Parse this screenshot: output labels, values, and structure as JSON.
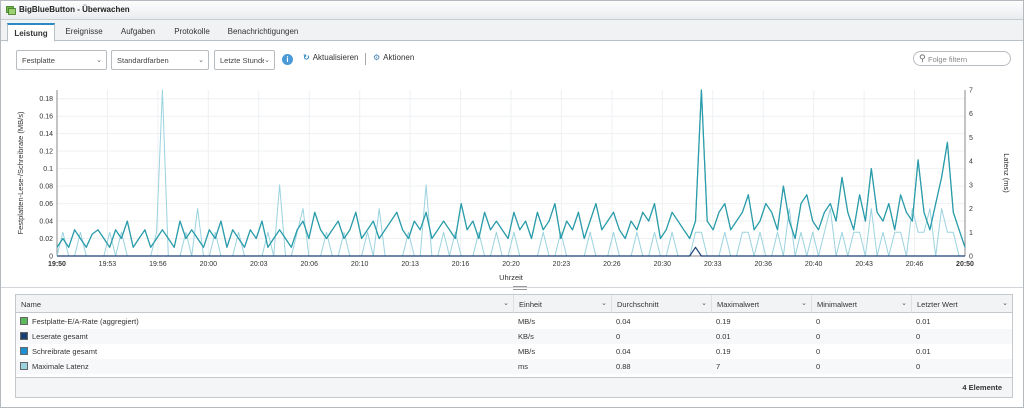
{
  "window": {
    "title": "BigBlueButton - Überwachen"
  },
  "tabs": [
    "Leistung",
    "Ereignisse",
    "Aufgaben",
    "Protokolle",
    "Benachrichtigungen"
  ],
  "toolbar": {
    "metric_select": "Festplatte",
    "color_select": "Standardfarben",
    "range_select": "Letzte Stunde",
    "refresh_label": "Aktualisieren",
    "actions_label": "Aktionen",
    "filter_placeholder": "Folge filtern"
  },
  "chart_data": {
    "type": "line",
    "xlabel": "Uhrzeit",
    "ylabel_left": "Festplatten-Lese-/Schreibrate (MB/s)",
    "ylabel_right": "Latenz (ms)",
    "ylim_left": [
      0,
      0.19
    ],
    "ylim_right": [
      0,
      7
    ],
    "yticks_left": [
      "0",
      "0.02",
      "0.04",
      "0.06",
      "0.08",
      "0.1",
      "0.12",
      "0.14",
      "0.16",
      "0.18"
    ],
    "yticks_right": [
      "0",
      "1",
      "2",
      "3",
      "4",
      "5",
      "6",
      "7"
    ],
    "xticks": [
      "19:50",
      "19:53",
      "19:56",
      "20:00",
      "20:03",
      "20:06",
      "20:10",
      "20:13",
      "20:16",
      "20:20",
      "20:23",
      "20:26",
      "20:30",
      "20:33",
      "20:36",
      "20:40",
      "20:43",
      "20:46",
      "20:50"
    ],
    "grid": true,
    "series": [
      {
        "name": "Festplatte-E/A-Rate (aggregiert)",
        "color": "#5cb85c",
        "values": [
          0.01,
          0.02,
          0.01,
          0.03,
          0.02,
          0.01,
          0.025,
          0.03,
          0.02,
          0.01,
          0.03,
          0.02,
          0.04,
          0.01,
          0.02,
          0.03,
          0.01,
          0.02,
          0.03,
          0.02,
          0.01,
          0.04,
          0.02,
          0.03,
          0.02,
          0.01,
          0.03,
          0.02,
          0.04,
          0.01,
          0.03,
          0.02,
          0.01,
          0.03,
          0.02,
          0.04,
          0.01,
          0.02,
          0.03,
          0.02,
          0.01,
          0.03,
          0.04,
          0.02,
          0.05,
          0.03,
          0.02,
          0.03,
          0.04,
          0.02,
          0.03,
          0.05,
          0.02,
          0.03,
          0.04,
          0.02,
          0.03,
          0.04,
          0.05,
          0.03,
          0.02,
          0.04,
          0.03,
          0.05,
          0.02,
          0.03,
          0.04,
          0.03,
          0.02,
          0.06,
          0.03,
          0.04,
          0.02,
          0.05,
          0.03,
          0.04,
          0.03,
          0.02,
          0.05,
          0.03,
          0.04,
          0.02,
          0.05,
          0.03,
          0.04,
          0.06,
          0.02,
          0.04,
          0.03,
          0.05,
          0.02,
          0.04,
          0.06,
          0.03,
          0.04,
          0.05,
          0.03,
          0.02,
          0.04,
          0.03,
          0.05,
          0.04,
          0.06,
          0.02,
          0.03,
          0.05,
          0.04,
          0.03,
          0.02,
          0.04,
          0.19,
          0.04,
          0.03,
          0.05,
          0.06,
          0.03,
          0.04,
          0.05,
          0.07,
          0.03,
          0.04,
          0.06,
          0.05,
          0.03,
          0.08,
          0.04,
          0.02,
          0.06,
          0.07,
          0.04,
          0.03,
          0.05,
          0.06,
          0.04,
          0.09,
          0.05,
          0.03,
          0.07,
          0.04,
          0.1,
          0.05,
          0.04,
          0.06,
          0.03,
          0.07,
          0.05,
          0.04,
          0.11,
          0.05,
          0.03,
          0.06,
          0.09,
          0.13,
          0.05,
          0.03,
          0.01
        ]
      },
      {
        "name": "Leserate gesamt",
        "color": "#1c3f73",
        "values": [
          0,
          0,
          0,
          0,
          0,
          0,
          0,
          0,
          0,
          0,
          0,
          0,
          0,
          0,
          0,
          0,
          0,
          0,
          0,
          0,
          0,
          0,
          0,
          0,
          0,
          0,
          0,
          0,
          0,
          0,
          0,
          0,
          0,
          0,
          0,
          0,
          0,
          0,
          0,
          0,
          0,
          0,
          0,
          0,
          0,
          0,
          0,
          0,
          0,
          0,
          0,
          0,
          0,
          0,
          0,
          0,
          0,
          0,
          0,
          0,
          0,
          0,
          0,
          0,
          0,
          0,
          0,
          0,
          0,
          0,
          0,
          0,
          0,
          0,
          0,
          0,
          0,
          0,
          0,
          0,
          0,
          0,
          0,
          0,
          0,
          0,
          0,
          0,
          0,
          0,
          0,
          0,
          0,
          0,
          0,
          0,
          0,
          0,
          0,
          0,
          0,
          0,
          0,
          0,
          0,
          0,
          0,
          0,
          0,
          0.01,
          0,
          0,
          0,
          0,
          0,
          0,
          0,
          0,
          0,
          0,
          0,
          0,
          0,
          0,
          0,
          0,
          0,
          0,
          0,
          0,
          0,
          0,
          0,
          0,
          0,
          0,
          0,
          0,
          0,
          0,
          0,
          0,
          0,
          0,
          0,
          0,
          0,
          0,
          0,
          0,
          0,
          0,
          0,
          0,
          0,
          0
        ]
      },
      {
        "name": "Schreibrate gesamt",
        "color": "#2a9bb5",
        "values": [
          0.01,
          0.02,
          0.01,
          0.03,
          0.02,
          0.01,
          0.025,
          0.03,
          0.02,
          0.01,
          0.03,
          0.02,
          0.04,
          0.01,
          0.02,
          0.03,
          0.01,
          0.02,
          0.03,
          0.02,
          0.01,
          0.04,
          0.02,
          0.03,
          0.02,
          0.01,
          0.03,
          0.02,
          0.04,
          0.01,
          0.03,
          0.02,
          0.01,
          0.03,
          0.02,
          0.04,
          0.01,
          0.02,
          0.03,
          0.02,
          0.01,
          0.03,
          0.04,
          0.02,
          0.05,
          0.03,
          0.02,
          0.03,
          0.04,
          0.02,
          0.03,
          0.05,
          0.02,
          0.03,
          0.04,
          0.02,
          0.03,
          0.04,
          0.05,
          0.03,
          0.02,
          0.04,
          0.03,
          0.05,
          0.02,
          0.03,
          0.04,
          0.03,
          0.02,
          0.06,
          0.03,
          0.04,
          0.02,
          0.05,
          0.03,
          0.04,
          0.03,
          0.02,
          0.05,
          0.03,
          0.04,
          0.02,
          0.05,
          0.03,
          0.04,
          0.06,
          0.02,
          0.04,
          0.03,
          0.05,
          0.02,
          0.04,
          0.06,
          0.03,
          0.04,
          0.05,
          0.03,
          0.02,
          0.04,
          0.03,
          0.05,
          0.04,
          0.06,
          0.02,
          0.03,
          0.05,
          0.04,
          0.03,
          0.02,
          0.04,
          0.19,
          0.04,
          0.03,
          0.05,
          0.06,
          0.03,
          0.04,
          0.05,
          0.07,
          0.03,
          0.04,
          0.06,
          0.05,
          0.03,
          0.08,
          0.04,
          0.02,
          0.06,
          0.07,
          0.04,
          0.03,
          0.05,
          0.06,
          0.04,
          0.09,
          0.05,
          0.03,
          0.07,
          0.04,
          0.1,
          0.05,
          0.04,
          0.06,
          0.03,
          0.07,
          0.05,
          0.04,
          0.11,
          0.05,
          0.03,
          0.06,
          0.09,
          0.13,
          0.05,
          0.03,
          0.01
        ]
      },
      {
        "name": "Maximale Latenz",
        "color": "#9bd3df",
        "axis": "right",
        "values": [
          0,
          1,
          0,
          0,
          1,
          0,
          0,
          0,
          0,
          1,
          0,
          1,
          0,
          0,
          0,
          0,
          0,
          1,
          7,
          0,
          0,
          0,
          1,
          0,
          2,
          0,
          0,
          1,
          0,
          0,
          0,
          1,
          0,
          0,
          0,
          0,
          1,
          0,
          3,
          0,
          0,
          1,
          2,
          0,
          0,
          0,
          1,
          0,
          0,
          1,
          0,
          0,
          0,
          1,
          0,
          2,
          0,
          0,
          0,
          0,
          1,
          0,
          0,
          3,
          0,
          0,
          1,
          0,
          1,
          0,
          0,
          0,
          1,
          0,
          0,
          1,
          0,
          0,
          1,
          0,
          0,
          0,
          0,
          1,
          0,
          0,
          1,
          0,
          0,
          0,
          0,
          1,
          0,
          0,
          0,
          1,
          0,
          0,
          0,
          1,
          0,
          0,
          1,
          0,
          0,
          1,
          0,
          0,
          0,
          1,
          1,
          0,
          0,
          0,
          1,
          0,
          0,
          1,
          1,
          0,
          1,
          0,
          0,
          1,
          0,
          2,
          0,
          1,
          0,
          1,
          0,
          1,
          2,
          0,
          1,
          0,
          1,
          1,
          0,
          2,
          0,
          1,
          0,
          1,
          1,
          0,
          2,
          1,
          1,
          2,
          0,
          2,
          1,
          1,
          0,
          0
        ]
      }
    ]
  },
  "table": {
    "columns": [
      "Name",
      "Einheit",
      "Durchschnitt",
      "Maximalwert",
      "Minimalwert",
      "Letzter Wert"
    ],
    "rows": [
      {
        "color": "#5cb85c",
        "cells": [
          "Festplatte-E/A-Rate (aggregiert)",
          "MB/s",
          "0.04",
          "0.19",
          "0",
          "0.01"
        ]
      },
      {
        "color": "#1c3f73",
        "cells": [
          "Leserate gesamt",
          "KB/s",
          "0",
          "0.01",
          "0",
          "0"
        ]
      },
      {
        "color": "#1f8fd0",
        "cells": [
          "Schreibrate gesamt",
          "MB/s",
          "0.04",
          "0.19",
          "0",
          "0.01"
        ]
      },
      {
        "color": "#9bd3df",
        "cells": [
          "Maximale Latenz",
          "ms",
          "0.88",
          "7",
          "0",
          "0"
        ]
      }
    ],
    "footer": "4 Elemente"
  }
}
